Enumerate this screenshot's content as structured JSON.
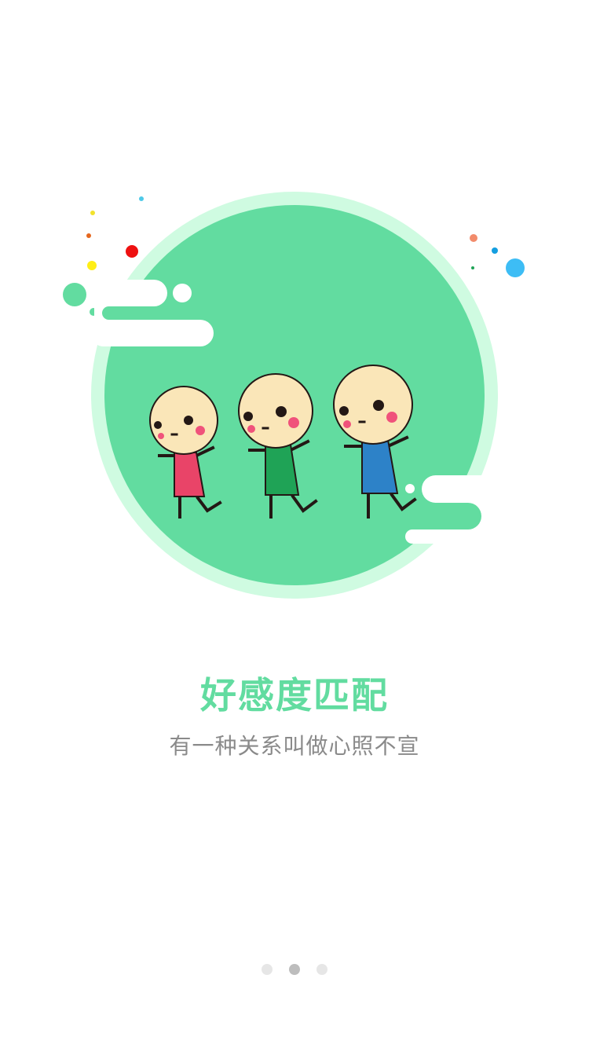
{
  "onboarding": {
    "title": "好感度匹配",
    "subtitle": "有一种关系叫做心照不宣",
    "illustration_icon": "three-kids-walking-illustration",
    "current_page": 2,
    "page_count": 3
  },
  "colors": {
    "accent": "#62DCA0",
    "circle_ring": "#CFFBE1",
    "subtitle_text": "#8A8A8A",
    "dot_active": "#BDBDBD",
    "dot_inactive": "#E6E6E6",
    "skin": "#FAE6B8",
    "cheek": "#F0527B",
    "kid_left_shirt": "#E94468",
    "kid_middle_shirt": "#1FA356",
    "kid_right_shirt": "#2D82C8"
  }
}
